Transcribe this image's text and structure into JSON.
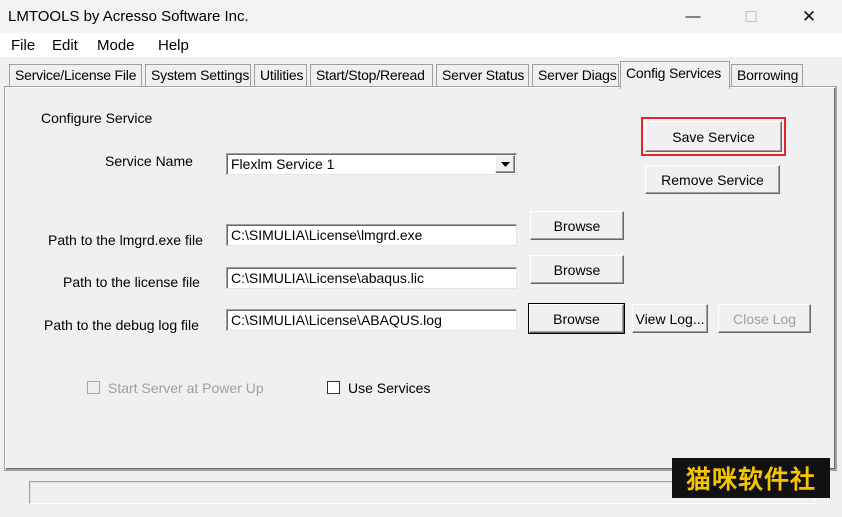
{
  "window": {
    "title": "LMTOOLS by Acresso Software Inc.",
    "minimize_glyph": "—",
    "maximize_glyph": "☐",
    "close_glyph": "✕"
  },
  "menu": [
    "File",
    "Edit",
    "Mode",
    "Help"
  ],
  "tabs": [
    {
      "label": "Service/License File"
    },
    {
      "label": "System Settings"
    },
    {
      "label": "Utilities"
    },
    {
      "label": "Start/Stop/Reread"
    },
    {
      "label": "Server Status"
    },
    {
      "label": "Server Diags"
    },
    {
      "label": "Config Services"
    },
    {
      "label": "Borrowing"
    }
  ],
  "active_tab": "Config Services",
  "config": {
    "section_label": "Configure Service",
    "service_name_label": "Service Name",
    "service_name_value": "Flexlm Service 1",
    "lmgrd_label": "Path to the lmgrd.exe file",
    "lmgrd_value": "C:\\SIMULIA\\License\\lmgrd.exe",
    "license_label": "Path to the license file",
    "license_value": "C:\\SIMULIA\\License\\abaqus.lic",
    "debug_label": "Path to the debug log file",
    "debug_value": "C:\\SIMULIA\\License\\ABAQUS.log",
    "browse_label": "Browse",
    "view_log_label": "View Log...",
    "close_log_label": "Close Log",
    "save_service_label": "Save Service",
    "remove_service_label": "Remove Service",
    "start_at_power_up_label": "Start Server at Power Up",
    "use_services_label": "Use Services"
  },
  "status": {
    "text": ""
  },
  "watermark": {
    "text": "猫咪软件社"
  },
  "colors": {
    "highlight": "#e4262a",
    "watermark_bg": "#111111",
    "watermark_fg": "#f7c400"
  }
}
